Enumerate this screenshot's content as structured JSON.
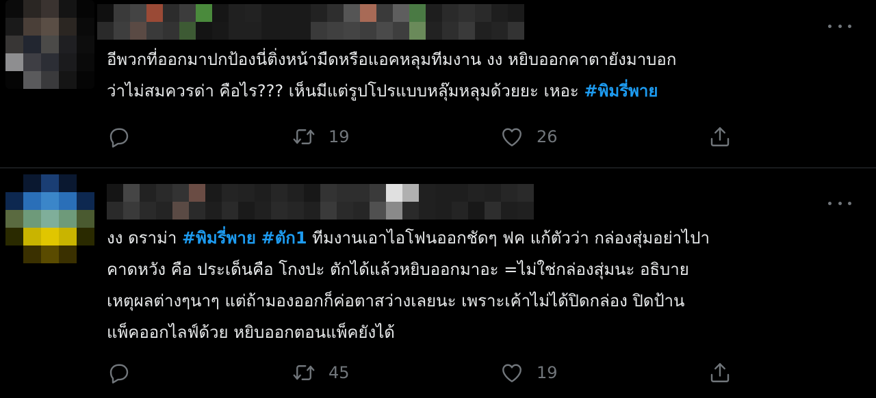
{
  "tweets": [
    {
      "text_lines": [
        [
          {
            "t": "อีพวกที่ออกมาปกป้องนี่ติ่งหน้ามืดหรือแอคหลุมทีมงาน งง หยิบออกคาตายังมาบอก"
          }
        ],
        [
          {
            "t": "ว่าไม่สมควรด่า คือไร??? เห็นมีแต่รูปโปรแบบหลุ๊มหลุมด้วยยะ เหอะ "
          },
          {
            "t": "#พิมรี่พาย"
          }
        ]
      ],
      "retweets": "19",
      "likes": "26"
    },
    {
      "text_lines": [
        [
          {
            "t": "งง ดราม่า "
          },
          {
            "t": "#พิมรี่พาย"
          },
          {
            "t": " "
          },
          {
            "t": "#ตัก1"
          },
          {
            "t": " ทีมงานเอาไอโฟนออกชัดๆ ฟค แก้ตัวว่า กล่องสุ่มอย่าไปา"
          }
        ],
        [
          {
            "t": "คาดหวัง คือ ประเด็นคือ โกงปะ ตักได้แล้วหยิบออกมาอะ =ไม่ใช่กล่องสุ่มนะ อธิบาย"
          }
        ],
        [
          {
            "t": "เหตุผลต่างๆนาๆ แต่ถ้ามองออกก็ค่อตาสว่างเลยนะ เพราะเค้าไม่ได้ปิดกล่อง ปิดป้าน"
          }
        ],
        [
          {
            "t": "แพ็คออกไลฟ์ด้วย หยิบออกตอนแพ็คยังได้"
          }
        ]
      ],
      "retweets": "45",
      "likes": "19"
    }
  ],
  "icons": {
    "reply": "reply-icon",
    "retweet": "retweet-icon",
    "like": "heart-icon",
    "share": "share-icon",
    "more": "more-dots-icon"
  },
  "colors": {
    "background": "#000000",
    "text": "#e7e9ea",
    "hashtag": "#1d9bf0",
    "muted": "#71767b",
    "divider": "#2f3336"
  },
  "avatar1_pixels": [
    "#0b0b0b",
    "#2a2623",
    "#3a3330",
    "#141414",
    "#050505",
    "#1a1a1a",
    "#4a3f38",
    "#5a4e45",
    "#2b2622",
    "#0a0a0a",
    "#383635",
    "#222630",
    "#4b4a48",
    "#1f1f22",
    "#0d0d0d",
    "#8e8e90",
    "#3e3e44",
    "#2c2e35",
    "#1b1b1d",
    "#0a0a0a",
    "#050505",
    "#5a5a5c",
    "#3a3a3c",
    "#151515",
    "#050505"
  ],
  "avatar2_pixels": [
    "#000000",
    "#0a1830",
    "#1a3e74",
    "#0a1830",
    "#000000",
    "#0d2850",
    "#2a6fb8",
    "#3b86c9",
    "#2a6fb8",
    "#0d2850",
    "#5a6a40",
    "#6e9a7a",
    "#7fae9a",
    "#6e9a7a",
    "#4a5a30",
    "#2a2a00",
    "#c9b400",
    "#e0c600",
    "#c9b400",
    "#2a2a00",
    "#000000",
    "#3a3000",
    "#5a4b00",
    "#3a3000",
    "#000000"
  ],
  "name1_pixels": [
    "#101010",
    "#2a2a2a",
    "#3a3a3a",
    "#3e3e3e",
    "#444444",
    "#5a4a44",
    "#9a4a36",
    "#3a3a3a",
    "#2c2c2c",
    "#333333",
    "#3c3c3c",
    "#3d5a34",
    "#4a8a3c",
    "#141414",
    "#161616",
    "#181818",
    "#202020",
    "#202020",
    "#222222",
    "#202020",
    "#1a1a1a",
    "#1a1a1a",
    "#1a1a1a",
    "#1a1a1a",
    "#1a1a1a",
    "#1a1a1a",
    "#222222",
    "#3a3a3a",
    "#2e2e2e",
    "#404040",
    "#555555",
    "#444444",
    "#a86a56",
    "#3e3e3e",
    "#3a3a3a",
    "#4a4a4a",
    "#5e5e5e",
    "#3e3e3e",
    "#4a7a44",
    "#6a8a5a",
    "#1e1e1e",
    "#222222",
    "#2a2a2a",
    "#2e2e2e",
    "#303030",
    "#3a3a3a",
    "#2a2a2a",
    "#202020",
    "#1e1e1e",
    "#242424",
    "#1a1a1a",
    "#333333"
  ],
  "name2_pixels": [
    "#151515",
    "#2a2a2a",
    "#454545",
    "#3a3a3a",
    "#222222",
    "#2a2a2a",
    "#2a2a2a",
    "#242424",
    "#333333",
    "#5a4a44",
    "#6a4c44",
    "#2a2a2a",
    "#1a1a1a",
    "#1e1e1e",
    "#242424",
    "#2a2a2a",
    "#222222",
    "#1a1a1a",
    "#1e1e1e",
    "#202020",
    "#262626",
    "#2a2a2a",
    "#202020",
    "#262626",
    "#181818",
    "#202020",
    "#333333",
    "#3a3a3a",
    "#2e2e2e",
    "#2a2a2a",
    "#2e2e2e",
    "#262626",
    "#3a3a3a",
    "#505050",
    "#e0e0e0",
    "#8a8a8a",
    "#b0b0b0",
    "#2a2a2a",
    "#202020",
    "#202020",
    "#1e1e1e",
    "#1e1e1e",
    "#1e1e1e",
    "#242424",
    "#222222",
    "#181818",
    "#202020",
    "#2e2e2e",
    "#262626",
    "#1e1e1e",
    "#2a2a2a",
    "#202020"
  ]
}
